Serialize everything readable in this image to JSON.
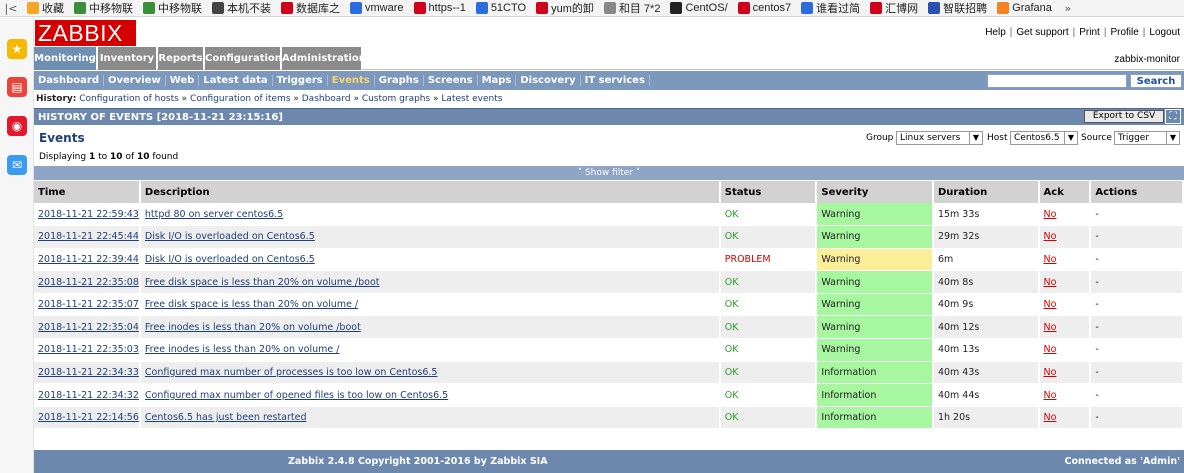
{
  "browser": {
    "bookmarks": [
      {
        "label": "收藏",
        "icon": "star-icon",
        "color": "#f5a623"
      },
      {
        "label": "中移物联",
        "icon": "leaf-icon",
        "color": "#3a8f3a"
      },
      {
        "label": "中移物联",
        "icon": "leaf-icon",
        "color": "#3a8f3a"
      },
      {
        "label": "本机不装",
        "icon": "fork-icon",
        "color": "#444444"
      },
      {
        "label": "数据库之",
        "icon": "c-icon",
        "color": "#d0021b"
      },
      {
        "label": "vmware",
        "icon": "paw-icon",
        "color": "#2d6cdf"
      },
      {
        "label": "https--1",
        "icon": "huawei-icon",
        "color": "#d0021b"
      },
      {
        "label": "51CTO",
        "icon": "box-icon",
        "color": "#2d6cdf"
      },
      {
        "label": "yum的卸",
        "icon": "c-icon",
        "color": "#d0021b"
      },
      {
        "label": "和目 7*2",
        "icon": "page-icon",
        "color": "#888888"
      },
      {
        "label": "CentOS/",
        "icon": "penguin-icon",
        "color": "#222222"
      },
      {
        "label": "centos7",
        "icon": "c-icon",
        "color": "#d0021b"
      },
      {
        "label": "谁看过简",
        "icon": "hand-icon",
        "color": "#2d6cdf"
      },
      {
        "label": "汇博网",
        "icon": "h-icon",
        "color": "#d0021b"
      },
      {
        "label": "智联招聘",
        "icon": "globe-icon",
        "color": "#2d4fb0"
      },
      {
        "label": "Grafana",
        "icon": "grafana-icon",
        "color": "#f58220"
      }
    ],
    "nav_back": "|<",
    "nav_more": "»"
  },
  "sidebar_icons": [
    {
      "name": "favorites-icon",
      "glyph": "★",
      "color": "#f5b800"
    },
    {
      "name": "notes-icon",
      "glyph": "▤",
      "color": "#e8453c"
    },
    {
      "name": "weibo-icon",
      "glyph": "◉",
      "color": "#e6162d"
    },
    {
      "name": "mail-icon",
      "glyph": "✉",
      "color": "#3b9bf0"
    }
  ],
  "header": {
    "logo": "ZABBIX",
    "links": [
      "Help",
      "Get support",
      "Print",
      "Profile",
      "Logout"
    ],
    "server_name": "zabbix-monitor"
  },
  "menu": {
    "tabs": [
      "Monitoring",
      "Inventory",
      "Reports",
      "Configuration",
      "Administration"
    ],
    "active": "Monitoring"
  },
  "submenu": {
    "items": [
      "Dashboard",
      "Overview",
      "Web",
      "Latest data",
      "Triggers",
      "Events",
      "Graphs",
      "Screens",
      "Maps",
      "Discovery",
      "IT services"
    ],
    "active": "Events",
    "search_button": "Search",
    "search_value": ""
  },
  "history": {
    "label": "History:",
    "crumbs": [
      "Configuration of hosts",
      "Configuration of items",
      "Dashboard",
      "Custom graphs",
      "Latest events"
    ]
  },
  "page": {
    "title": "HISTORY OF EVENTS [2018-11-21 23:15:16]",
    "export_button": "Export to CSV",
    "events_title": "Events",
    "displaying_prefix": "Displaying",
    "displaying_from": "1",
    "displaying_to_word": "to",
    "displaying_to": "10",
    "displaying_of_word": "of",
    "displaying_total": "10",
    "displaying_suffix": "found",
    "filters": {
      "group_label": "Group",
      "group_value": "Linux servers",
      "host_label": "Host",
      "host_value": "Centos6.5",
      "source_label": "Source",
      "source_value": "Trigger"
    },
    "show_filter": "Show filter"
  },
  "table": {
    "columns": [
      "Time",
      "Description",
      "Status",
      "Severity",
      "Duration",
      "Ack",
      "Actions"
    ],
    "rows": [
      {
        "time": "2018-11-21 22:59:43",
        "description": "httpd 80 on server centos6.5",
        "status": "OK",
        "severity": "Warning",
        "duration": "15m 33s",
        "ack": "No",
        "actions": "-"
      },
      {
        "time": "2018-11-21 22:45:44",
        "description": "Disk I/O is overloaded on Centos6.5",
        "status": "OK",
        "severity": "Warning",
        "duration": "29m 32s",
        "ack": "No",
        "actions": "-"
      },
      {
        "time": "2018-11-21 22:39:44",
        "description": "Disk I/O is overloaded on Centos6.5",
        "status": "PROBLEM",
        "severity": "Warning",
        "duration": "6m",
        "ack": "No",
        "actions": "-"
      },
      {
        "time": "2018-11-21 22:35:08",
        "description": "Free disk space is less than 20% on volume /boot",
        "status": "OK",
        "severity": "Warning",
        "duration": "40m 8s",
        "ack": "No",
        "actions": "-"
      },
      {
        "time": "2018-11-21 22:35:07",
        "description": "Free disk space is less than 20% on volume /",
        "status": "OK",
        "severity": "Warning",
        "duration": "40m 9s",
        "ack": "No",
        "actions": "-"
      },
      {
        "time": "2018-11-21 22:35:04",
        "description": "Free inodes is less than 20% on volume /boot",
        "status": "OK",
        "severity": "Warning",
        "duration": "40m 12s",
        "ack": "No",
        "actions": "-"
      },
      {
        "time": "2018-11-21 22:35:03",
        "description": "Free inodes is less than 20% on volume /",
        "status": "OK",
        "severity": "Warning",
        "duration": "40m 13s",
        "ack": "No",
        "actions": "-"
      },
      {
        "time": "2018-11-21 22:34:33",
        "description": "Configured max number of processes is too low on Centos6.5",
        "status": "OK",
        "severity": "Information",
        "duration": "40m 43s",
        "ack": "No",
        "actions": "-"
      },
      {
        "time": "2018-11-21 22:34:32",
        "description": "Configured max number of opened files is too low on Centos6.5",
        "status": "OK",
        "severity": "Information",
        "duration": "40m 44s",
        "ack": "No",
        "actions": "-"
      },
      {
        "time": "2018-11-21 22:14:56",
        "description": "Centos6.5 has just been restarted",
        "status": "OK",
        "severity": "Information",
        "duration": "1h 20s",
        "ack": "No",
        "actions": "-"
      }
    ]
  },
  "footer": {
    "copyright": "Zabbix 2.4.8 Copyright 2001-2016 by Zabbix SIA",
    "connected": "Connected as 'Admin'"
  },
  "colors": {
    "logo_red": "#d40000",
    "menu_active": "#6f8fb3",
    "submenu_bg": "#7c98bd",
    "header_bg": "#6c88ad",
    "ok_green": "#2c9c2c",
    "problem_red": "#d40000",
    "severity_ok_bg": "#a6f7a0",
    "severity_problem_bg": "#fbee99"
  }
}
